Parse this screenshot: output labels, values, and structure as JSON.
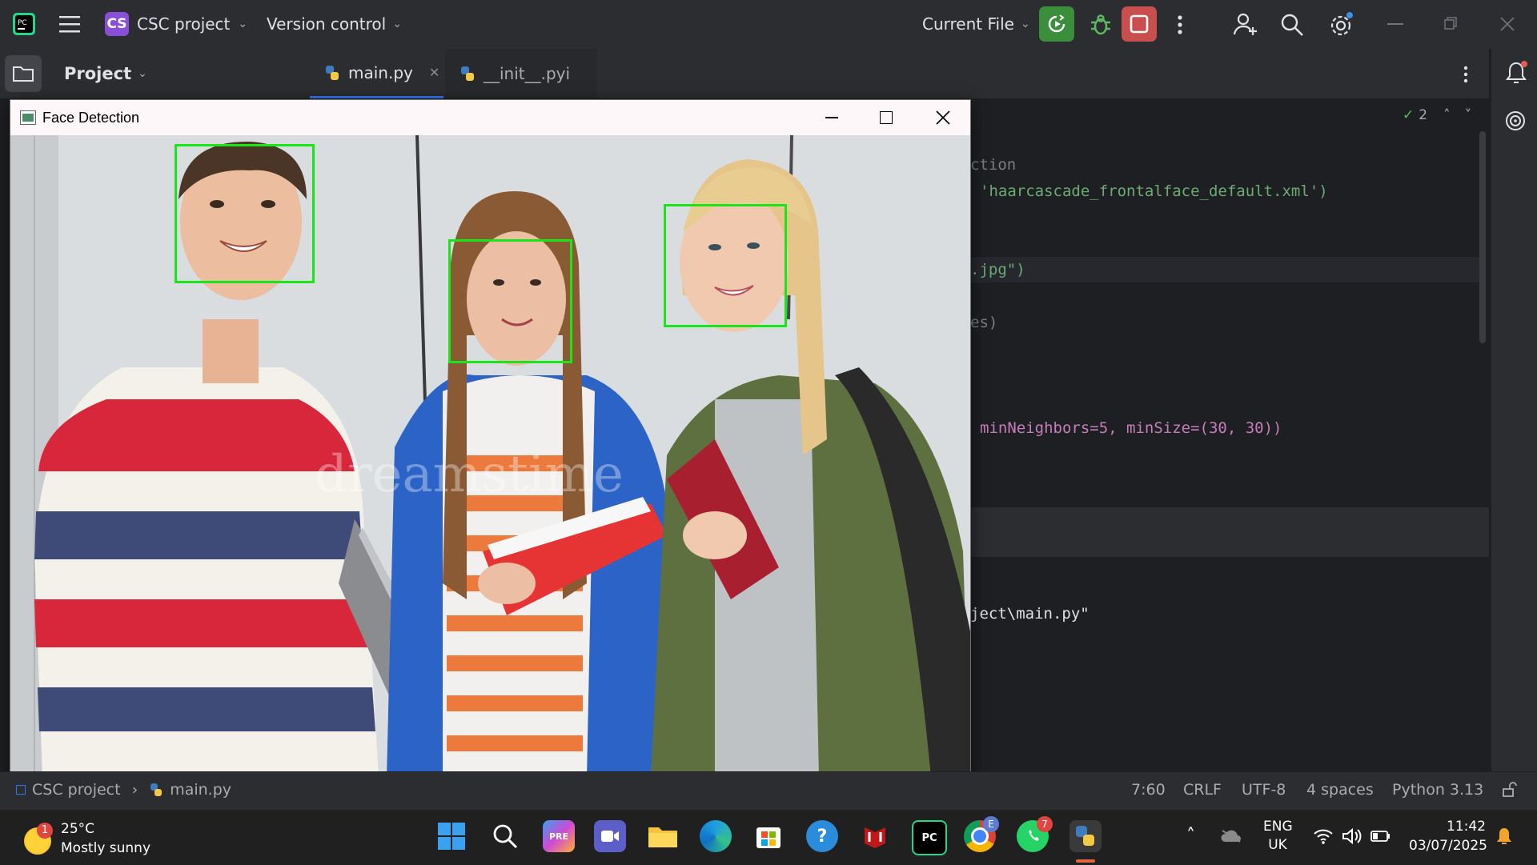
{
  "titlebar": {
    "project_badge": "CS",
    "project_name": "CSC project",
    "version_control": "Version control",
    "run_config": "Current File"
  },
  "toolrow": {
    "project_label": "Project",
    "tabs": [
      {
        "label": "main.py",
        "active": true
      },
      {
        "label": "__init__.pyi",
        "active": false
      }
    ],
    "inspection_count": "2"
  },
  "editor": {
    "lines": [
      {
        "text": "ction"
      },
      {
        "text": "'haarcascade_frontalface_default.xml')"
      },
      {
        "text": ".jpg\")"
      },
      {
        "text": "es)"
      },
      {
        "text": "minNeighbors=5, minSize=(30, 30))"
      }
    ],
    "console_line": "ject\\main.py\""
  },
  "face_window": {
    "title": "Face Detection",
    "watermark": "dreamstime",
    "faces_detected": 3
  },
  "statusbar": {
    "breadcrumb_project": "CSC project",
    "breadcrumb_file": "main.py",
    "position": "7:60",
    "line_ending": "CRLF",
    "encoding": "UTF-8",
    "indent": "4 spaces",
    "interpreter": "Python 3.13"
  },
  "taskbar": {
    "weather_temp": "25°C",
    "weather_desc": "Mostly sunny",
    "weather_badge": "1",
    "language_line1": "ENG",
    "language_line2": "UK",
    "time": "11:42",
    "date": "03/07/2025",
    "chrome_badge": "E",
    "whatsapp_badge": "7"
  },
  "colors": {
    "accent_run": "#3b8e3b",
    "accent_stop": "#c94f4f",
    "face_box": "#19e619",
    "project_badge": "#8a4fd8"
  }
}
